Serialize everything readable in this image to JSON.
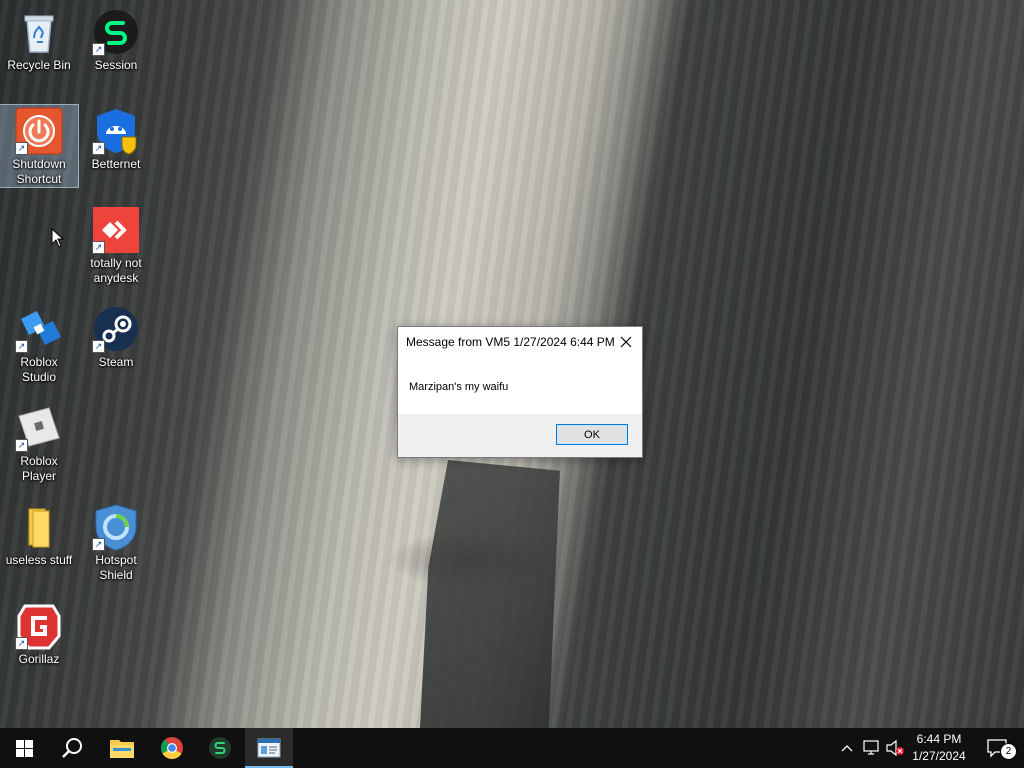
{
  "desktop": {
    "icons": [
      {
        "label": "Recycle Bin"
      },
      {
        "label": "Session"
      },
      {
        "label": "Shutdown Shortcut"
      },
      {
        "label": "Betternet"
      },
      {
        "label": "totally not anydesk"
      },
      {
        "label": "Roblox Studio"
      },
      {
        "label": "Steam"
      },
      {
        "label": "Roblox Player"
      },
      {
        "label": "useless stuff"
      },
      {
        "label": "Hotspot Shield"
      },
      {
        "label": "Gorillaz"
      }
    ]
  },
  "dialog": {
    "title": "Message from VM5 1/27/2024 6:44 PM",
    "message": "Marzipan's my waifu",
    "ok_label": "OK"
  },
  "taskbar": {
    "clock_time": "6:44 PM",
    "clock_date": "1/27/2024",
    "notification_count": "2"
  },
  "colors": {
    "taskbar_bg": "#101010",
    "accent": "#0078d7",
    "active_indicator": "#76b9ed"
  }
}
